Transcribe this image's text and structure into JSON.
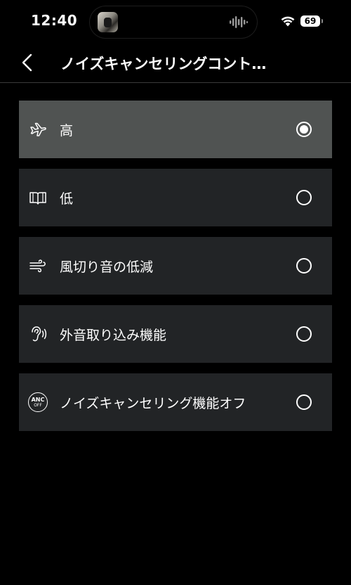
{
  "status_bar": {
    "time": "12:40",
    "battery": "69"
  },
  "header": {
    "title": "ノイズキャンセリングコント…"
  },
  "options": [
    {
      "label": "高",
      "icon": "airplane-icon",
      "selected": true
    },
    {
      "label": "低",
      "icon": "book-icon",
      "selected": false
    },
    {
      "label": "風切り音の低減",
      "icon": "wind-icon",
      "selected": false
    },
    {
      "label": "外音取り込み機能",
      "icon": "ear-sound-icon",
      "selected": false
    },
    {
      "label": "ノイズキャンセリング機能オフ",
      "icon": "anc-off-icon",
      "selected": false,
      "badge_top": "ANC",
      "badge_bottom": "OFF"
    }
  ],
  "colors": {
    "background": "#000000",
    "option_background": "#222426",
    "selected_background": "#505352",
    "text": "#ffffff"
  }
}
